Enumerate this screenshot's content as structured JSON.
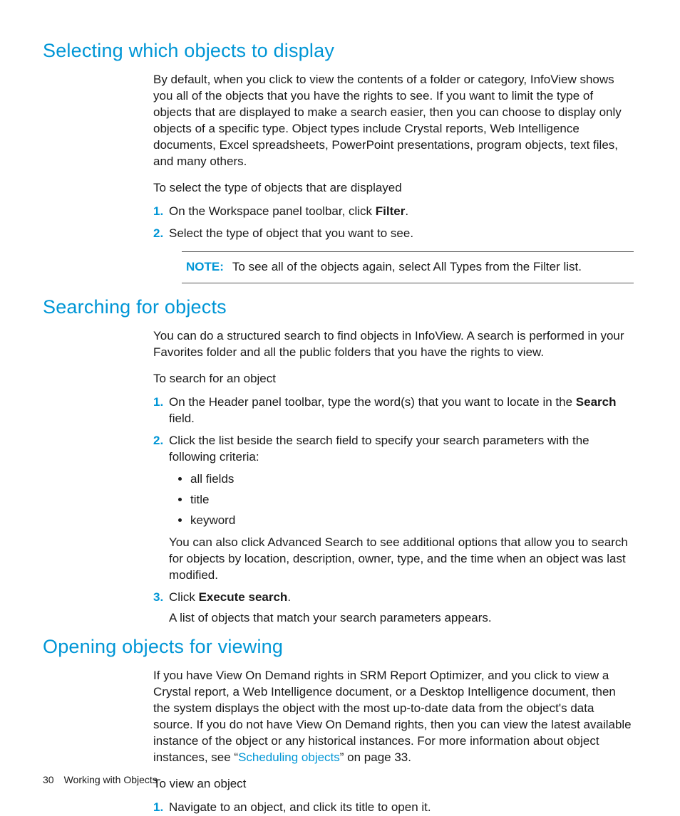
{
  "section1": {
    "heading": "Selecting which objects to display",
    "para": "By default, when you click to view the contents of a folder or category, InfoView shows you all of the objects that you have the rights to see. If you want to limit the type of objects that are displayed to make a search easier, then you can choose to display only objects of a specific type. Object types include Crystal reports, Web Intelligence documents, Excel spreadsheets, PowerPoint presentations, program objects, text files, and many others.",
    "lead": "To select the type of objects that are displayed",
    "step1_pre": "On the Workspace panel toolbar, click ",
    "step1_bold": "Filter",
    "step1_post": ".",
    "step2": "Select the type of object that you want to see.",
    "note_label": "NOTE:",
    "note_text": "To see all of the objects again, select All Types from the Filter list."
  },
  "section2": {
    "heading": "Searching for objects",
    "para": "You can do a structured search to find objects in InfoView. A search is performed in your Favorites folder and all the public folders that you have the rights to view.",
    "lead": "To search for an object",
    "step1_pre": "On the Header panel toolbar, type the word(s) that you want to locate in the ",
    "step1_bold": "Search",
    "step1_post": " field.",
    "step2_intro": "Click the list beside the search field to specify your search parameters with the following criteria:",
    "bullet1": "all fields",
    "bullet2": "title",
    "bullet3": "keyword",
    "step2_after": "You can also click Advanced Search to see additional options that allow you to search for objects by location, description, owner, type, and the time when an object was last modified.",
    "step3_pre": "Click ",
    "step3_bold": "Execute search",
    "step3_post": ".",
    "step3_after": "A list of objects that match your search parameters appears."
  },
  "section3": {
    "heading": "Opening objects for viewing",
    "para_pre": "If you have View On Demand rights in SRM Report Optimizer, and you click to view a Crystal report, a Web Intelligence document, or a Desktop Intelligence document, then the system displays the object with the most up-to-date data from the object's data source. If you do not have View On Demand rights, then you can view the latest available instance of the object or any historical instances. For more information about object instances, see “",
    "para_link": "Scheduling objects",
    "para_post": "” on page 33.",
    "lead": "To view an object",
    "step1": "Navigate to an object, and click its title to open it."
  },
  "footer": {
    "page_number": "30",
    "chapter": "Working with Objects"
  }
}
